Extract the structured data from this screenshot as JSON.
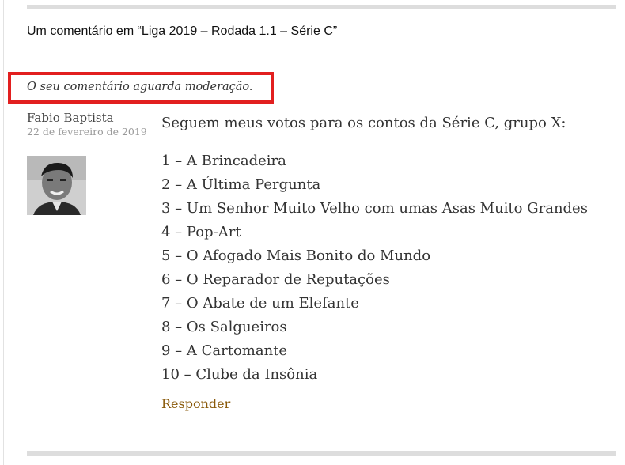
{
  "comments": {
    "title": "Um comentário em “Liga 2019 – Rodada 1.1 – Série C”"
  },
  "comment": {
    "moderation_note": "O seu comentário aguarda moderação.",
    "author": "Fabio Baptista",
    "date": "22 de fevereiro de 2019",
    "avatar_icon": "author-photo",
    "intro": "Seguem meus votos para os contos da Série C, grupo X:",
    "votes": [
      "1 – A Brincadeira",
      "2 – A Última Pergunta",
      "3 – Um Senhor Muito Velho com umas Asas Muito Grandes",
      "4 – Pop-Art",
      "5 – O Afogado Mais Bonito do Mundo",
      "6 – O Reparador de Reputações",
      "7 – O Abate de um Elefante",
      "8 – Os Salgueiros",
      "9 – A Cartomante",
      "10 – Clube da Insônia"
    ],
    "reply_label": "Responder"
  },
  "colors": {
    "highlight_border": "#e21f1f",
    "reply_link": "#8a5a0b"
  }
}
